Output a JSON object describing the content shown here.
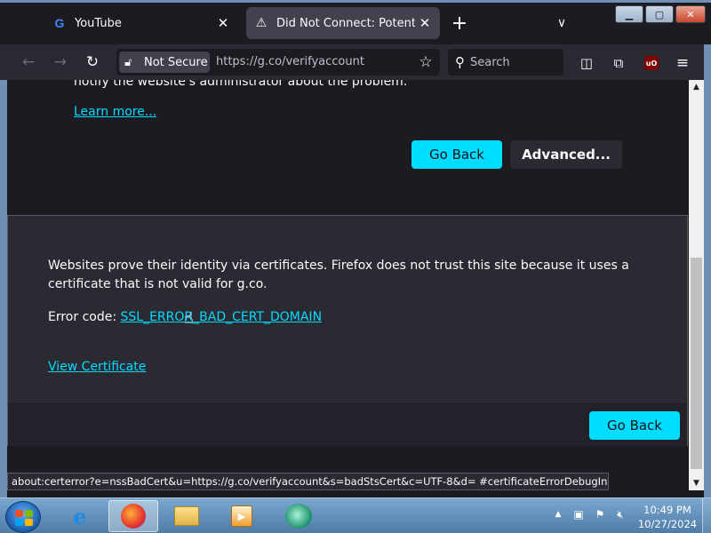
{
  "browser": {
    "tabs": [
      {
        "title": "YouTube",
        "icon": "google-g-icon",
        "active": false
      },
      {
        "title": "Did Not Connect: Potential Sec",
        "icon": "warning-icon",
        "active": true
      }
    ],
    "url_bar": {
      "security_label": "Not Secure",
      "url": "https://g.co/verifyaccount"
    },
    "search_placeholder": "Search"
  },
  "page": {
    "notify_text": "notify the website's administrator about the problem.",
    "learn_more": "Learn more...",
    "go_back_label": "Go Back",
    "advanced_label": "Advanced...",
    "advanced_panel": {
      "description": "Websites prove their identity via certificates. Firefox does not trust this site because it uses a certificate that is not valid for g.co.",
      "error_code_label": "Error code:",
      "error_code": "SSL_ERROR_BAD_CERT_DOMAIN",
      "view_certificate": "View Certificate",
      "go_back_label": "Go Back"
    }
  },
  "status_bar": "about:certerror?e=nssBadCert&u=https://g.co/verifyaccount&s=badStsCert&c=UTF-8&d= #certificateErrorDebugInformation",
  "taskbar": {
    "items": [
      "internet-explorer",
      "firefox",
      "windows-explorer",
      "media-player",
      "app"
    ],
    "clock_time": "10:49 PM",
    "clock_date": "10/27/2024"
  },
  "colors": {
    "accent": "#00ddff",
    "page_bg": "#1c1b22",
    "panel_bg": "#2b2a33",
    "text": "#fbfbfe"
  }
}
